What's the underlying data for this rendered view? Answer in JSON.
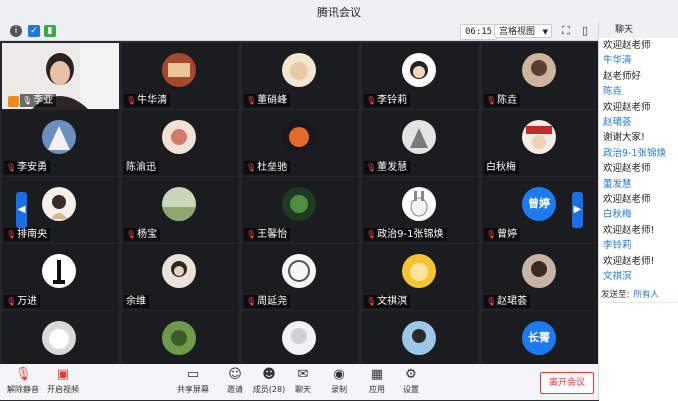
{
  "window": {
    "title": "腾讯会议"
  },
  "toolbar": {
    "timer": "06:15",
    "view_mode": "宫格视图"
  },
  "participants": [
    {
      "name": "李亚",
      "avatar": "video"
    },
    {
      "name": "牛华清"
    },
    {
      "name": "董硝峰"
    },
    {
      "name": "李铃莉"
    },
    {
      "name": "陈垚"
    },
    {
      "name": "李安勇"
    },
    {
      "name": "陈渝迅"
    },
    {
      "name": "杜垒驰"
    },
    {
      "name": "董发慧"
    },
    {
      "name": "白秋梅"
    },
    {
      "name": "排南央"
    },
    {
      "name": "杨宝"
    },
    {
      "name": "王馨怡"
    },
    {
      "name": "政治9-1张锦焕"
    },
    {
      "name": "曾婷",
      "avatar_text": "曾婷"
    },
    {
      "name": "万进"
    },
    {
      "name": "余维"
    },
    {
      "name": "周延尧"
    },
    {
      "name": "文祺溟"
    },
    {
      "name": "赵珺荟"
    },
    {
      "name": ""
    },
    {
      "name": ""
    },
    {
      "name": ""
    },
    {
      "name": ""
    },
    {
      "name": "",
      "avatar_text": "长菁"
    }
  ],
  "bottombar": {
    "mute": "解除静音",
    "video": "开启视频",
    "share": "共享屏幕",
    "invite": "邀请",
    "members": "成员(28)",
    "chat": "聊天",
    "record": "录制",
    "apps": "应用",
    "settings": "设置",
    "leave": "离开会议"
  },
  "chat": {
    "header": "聊天",
    "messages": [
      {
        "text": "欢迎赵老师",
        "sender": false
      },
      {
        "text": "牛华清",
        "sender": true
      },
      {
        "text": "赵老师好",
        "sender": false
      },
      {
        "text": "陈垚",
        "sender": true
      },
      {
        "text": "欢迎赵老师",
        "sender": false
      },
      {
        "text": "赵珺荟",
        "sender": true
      },
      {
        "text": "谢谢大家!",
        "sender": false
      },
      {
        "text": "政治9-1张锦焕",
        "sender": true
      },
      {
        "text": "欢迎赵老师",
        "sender": false
      },
      {
        "text": "董发慧",
        "sender": true
      },
      {
        "text": "欢迎赵老师",
        "sender": false
      },
      {
        "text": "白秋梅",
        "sender": true
      },
      {
        "text": "欢迎赵老师!",
        "sender": false
      },
      {
        "text": "李铃莉",
        "sender": true
      },
      {
        "text": "欢迎赵老师!",
        "sender": false
      },
      {
        "text": "文祺溟",
        "sender": true
      },
      {
        "text": "欢迎赵老师",
        "sender": false
      }
    ],
    "send_to_label": "发送至:",
    "send_to_target": "所有人"
  },
  "colors": {
    "accent": "#1e7ae0",
    "danger": "#e53935",
    "host": "#f08a1a",
    "active_speaker": "#1fb35e"
  }
}
